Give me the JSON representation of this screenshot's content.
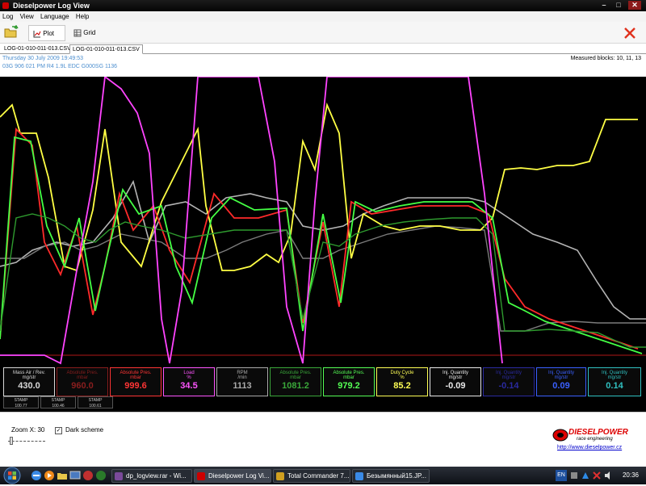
{
  "window": {
    "title": "Dieselpower Log View"
  },
  "menu": [
    "Log",
    "View",
    "Language",
    "Help"
  ],
  "toolbar": {
    "plot": "Plot",
    "grid": "Grid"
  },
  "files": [
    "LOG-01-010-011-013.CSV",
    "LOG-01-010-011-013.CSV"
  ],
  "info": {
    "date": "Thursday 30 July 2009 19:49:53",
    "ecu": "03G 906 021 PM  R4 1.9L EDC G000SG  1136",
    "measured": "Measured blocks: 10, 11, 13"
  },
  "colors": {
    "yellow": "#ffff44",
    "magenta": "#ff44ff",
    "red": "#ff2a2a",
    "green": "#44ff44",
    "darkgreen": "#2e9a2e",
    "gray": "#b4b4b4",
    "darkgray": "#7c7c7c"
  },
  "panels": [
    {
      "l1": "Mass Air / Rev.",
      "l2": "mg/str",
      "v": "430.0",
      "c": "#d8d8d8"
    },
    {
      "l1": "Absolute Pres.",
      "l2": "mbar",
      "v": "960.0",
      "c": "#8a1e1e"
    },
    {
      "l1": "Absolute Pres.",
      "l2": "mbar",
      "v": "999.6",
      "c": "#ff3535"
    },
    {
      "l1": "Load",
      "l2": "%",
      "v": "34.5",
      "c": "#ff55ff"
    },
    {
      "l1": "RPM",
      "l2": "/min",
      "v": "1113",
      "c": "#aaaaaa"
    },
    {
      "l1": "Absolute Pres.",
      "l2": "mbar",
      "v": "1081.2",
      "c": "#3aa83a"
    },
    {
      "l1": "Absolute Pres.",
      "l2": "mbar",
      "v": "979.2",
      "c": "#55ff55"
    },
    {
      "l1": "Duty Cycle",
      "l2": "%",
      "v": "85.2",
      "c": "#ffff55"
    },
    {
      "l1": "Inj. Quantity",
      "l2": "mg/str",
      "v": "-0.09",
      "c": "#e8e8e8"
    },
    {
      "l1": "Inj. Quantity",
      "l2": "mg/str",
      "v": "-0.14",
      "c": "#2a2aa0"
    },
    {
      "l1": "Inj. Quantity",
      "l2": "mg/str",
      "v": "0.09",
      "c": "#3a60ff"
    },
    {
      "l1": "Inj. Quantity",
      "l2": "mg/str",
      "v": "0.14",
      "c": "#30c0c0"
    }
  ],
  "stamps": [
    {
      "l": "STAMP",
      "v": "100.77"
    },
    {
      "l": "STAMP",
      "v": "100.46"
    },
    {
      "l": "STAMP",
      "v": "100.61"
    }
  ],
  "bottom": {
    "zoom": "Zoom X: 30",
    "dark": "Dark scheme",
    "brand": "DIESELPOWER",
    "brand_sub": "race engineering",
    "url": "http://www.dieselpower.cz"
  },
  "taskbar": {
    "tasks": [
      "dp_logview.rar - Wi...",
      "Dieselpower Log Vi...",
      "Total Commander 7...",
      "Безымянный15.JP..."
    ],
    "lang": "EN",
    "time": "20:36"
  }
}
